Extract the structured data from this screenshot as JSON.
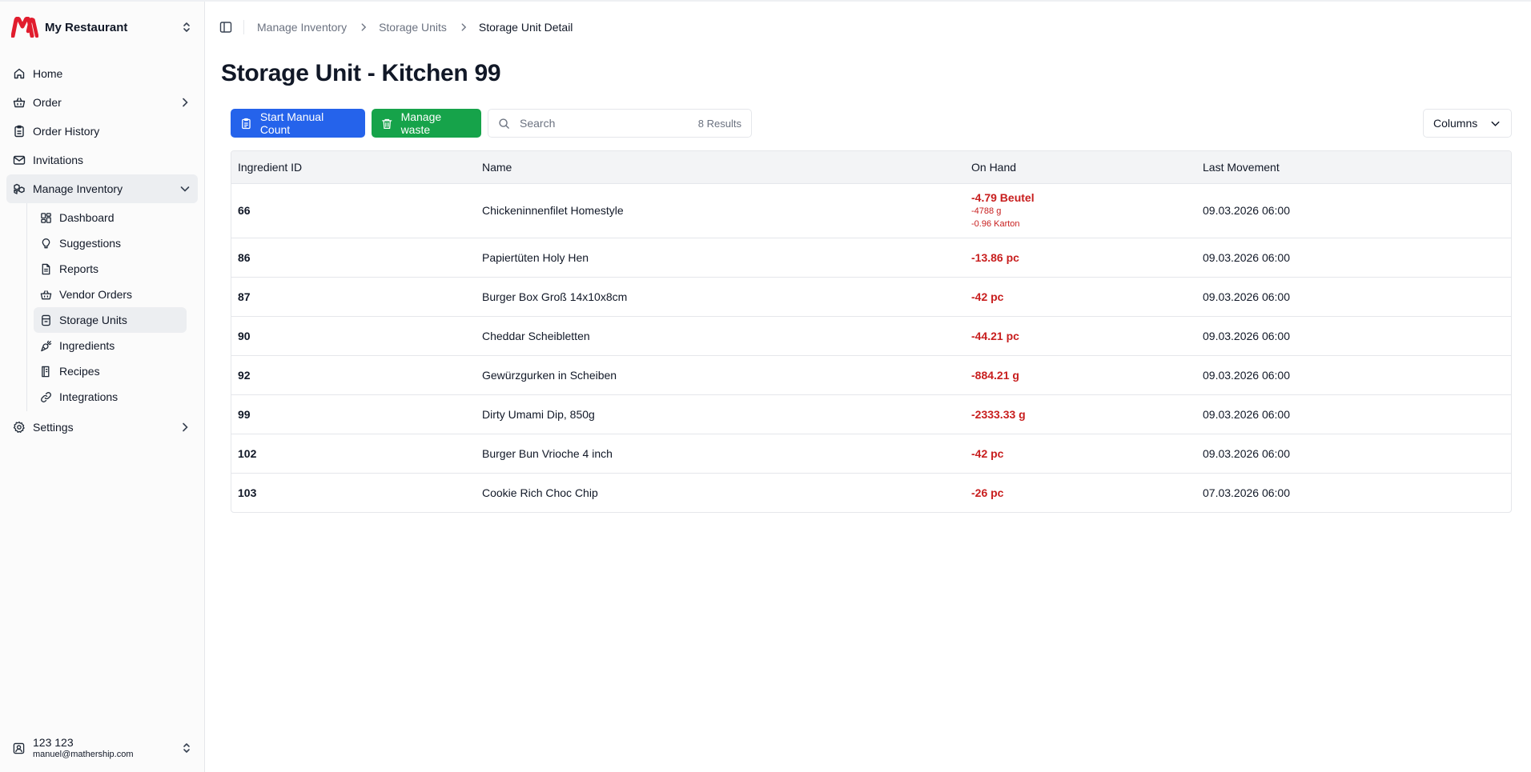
{
  "brand": {
    "name": "My Restaurant",
    "accent": "#e11d2e"
  },
  "sidebar": {
    "items": [
      {
        "label": "Home",
        "icon": "home-icon"
      },
      {
        "label": "Order",
        "icon": "basket-icon"
      },
      {
        "label": "Order History",
        "icon": "clipboard-icon"
      },
      {
        "label": "Invitations",
        "icon": "mail-icon"
      },
      {
        "label": "Manage Inventory",
        "icon": "boxes-icon"
      },
      {
        "label": "Settings",
        "icon": "gear-icon"
      }
    ],
    "sub_items": [
      {
        "label": "Dashboard",
        "icon": "dashboard-icon"
      },
      {
        "label": "Suggestions",
        "icon": "lightbulb-icon"
      },
      {
        "label": "Reports",
        "icon": "report-icon"
      },
      {
        "label": "Vendor Orders",
        "icon": "basket-icon"
      },
      {
        "label": "Storage Units",
        "icon": "cylinder-icon"
      },
      {
        "label": "Ingredients",
        "icon": "carrot-icon"
      },
      {
        "label": "Recipes",
        "icon": "recipe-icon"
      },
      {
        "label": "Integrations",
        "icon": "link-icon"
      }
    ],
    "user": {
      "name": "123 123",
      "email": "manuel@mathership.com"
    }
  },
  "breadcrumb": [
    "Manage Inventory",
    "Storage Units",
    "Storage Unit Detail"
  ],
  "page": {
    "title": "Storage Unit - Kitchen 99"
  },
  "toolbar": {
    "manual_count_label": "Start Manual Count",
    "manage_waste_label": "Manage waste",
    "search_placeholder": "Search",
    "results_label": "8 Results",
    "columns_label": "Columns",
    "primary_color": "#2563eb",
    "success_color": "#16a34a"
  },
  "table": {
    "headers": [
      "Ingredient ID",
      "Name",
      "On Hand",
      "Last Movement"
    ],
    "negative_color": "#c81e1e",
    "rows": [
      {
        "id": "66",
        "name": "Chickeninnenfilet Homestyle",
        "on_hand": "-4.79 Beutel",
        "on_hand_alt1": "-4788 g",
        "on_hand_alt2": "-0.96 Karton",
        "last_movement": "09.03.2026 06:00"
      },
      {
        "id": "86",
        "name": "Papiertüten Holy Hen",
        "on_hand": "-13.86 pc",
        "last_movement": "09.03.2026 06:00"
      },
      {
        "id": "87",
        "name": "Burger Box Groß 14x10x8cm",
        "on_hand": "-42 pc",
        "last_movement": "09.03.2026 06:00"
      },
      {
        "id": "90",
        "name": "Cheddar Scheibletten",
        "on_hand": "-44.21 pc",
        "last_movement": "09.03.2026 06:00"
      },
      {
        "id": "92",
        "name": "Gewürzgurken in Scheiben",
        "on_hand": "-884.21 g",
        "last_movement": "09.03.2026 06:00"
      },
      {
        "id": "99",
        "name": "Dirty Umami Dip, 850g",
        "on_hand": "-2333.33 g",
        "last_movement": "09.03.2026 06:00"
      },
      {
        "id": "102",
        "name": "Burger Bun Vrioche 4 inch",
        "on_hand": "-42 pc",
        "last_movement": "09.03.2026 06:00"
      },
      {
        "id": "103",
        "name": "Cookie Rich Choc Chip",
        "on_hand": "-26 pc",
        "last_movement": "07.03.2026 06:00"
      }
    ]
  }
}
